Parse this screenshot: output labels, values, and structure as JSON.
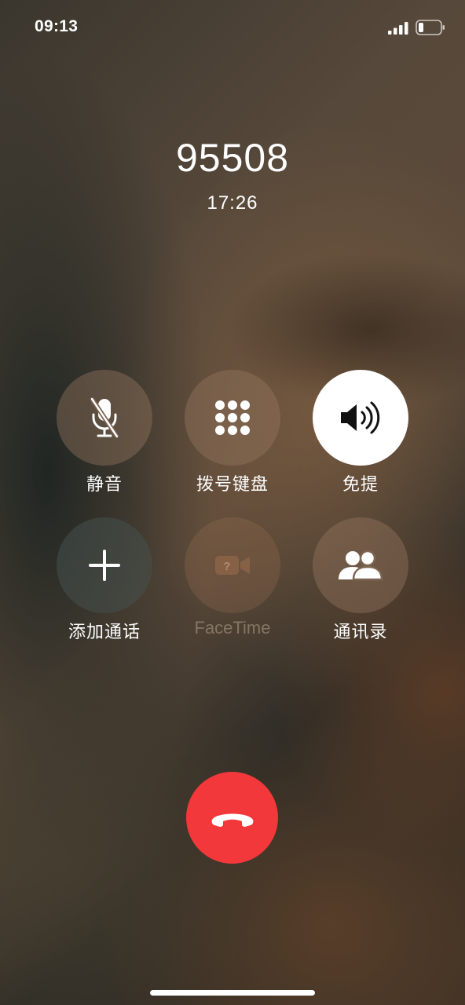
{
  "status_bar": {
    "time": "09:13",
    "signal_icon": "cellular-signal-icon",
    "battery_icon": "battery-icon"
  },
  "call": {
    "number": "95508",
    "duration": "17:26"
  },
  "controls": {
    "mute": {
      "label": "静音",
      "icon": "mic-off-icon"
    },
    "keypad": {
      "label": "拨号键盘",
      "icon": "keypad-icon"
    },
    "speaker": {
      "label": "免提",
      "icon": "speaker-icon",
      "active": true
    },
    "add_call": {
      "label": "添加通话",
      "icon": "plus-icon"
    },
    "facetime": {
      "label": "FaceTime",
      "icon": "video-camera-icon",
      "enabled": false
    },
    "contacts": {
      "label": "通讯录",
      "icon": "contacts-icon"
    }
  },
  "end_call": {
    "icon": "phone-hangup-icon",
    "color": "#f2383a"
  }
}
